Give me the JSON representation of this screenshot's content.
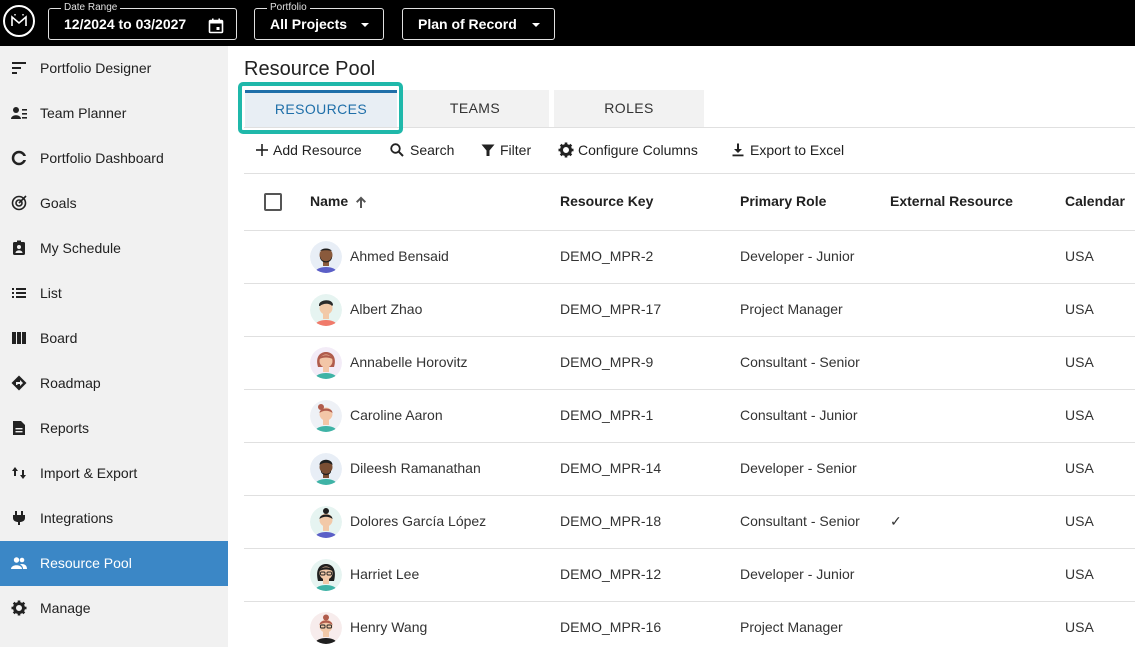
{
  "topbar": {
    "date_range": {
      "legend": "Date Range",
      "value": "12/2024 to 03/2027"
    },
    "portfolio": {
      "legend": "Portfolio",
      "value": "All Projects"
    },
    "plan": {
      "value": "Plan of Record"
    }
  },
  "sidebar": {
    "items": [
      {
        "label": "Portfolio Designer",
        "icon": "portfolio-designer-icon"
      },
      {
        "label": "Team Planner",
        "icon": "team-planner-icon"
      },
      {
        "label": "Portfolio Dashboard",
        "icon": "dashboard-icon"
      },
      {
        "label": "Goals",
        "icon": "goals-icon"
      },
      {
        "label": "My Schedule",
        "icon": "schedule-icon"
      },
      {
        "label": "List",
        "icon": "list-icon"
      },
      {
        "label": "Board",
        "icon": "board-icon"
      },
      {
        "label": "Roadmap",
        "icon": "roadmap-icon"
      },
      {
        "label": "Reports",
        "icon": "reports-icon"
      },
      {
        "label": "Import & Export",
        "icon": "import-export-icon"
      },
      {
        "label": "Integrations",
        "icon": "integrations-icon"
      },
      {
        "label": "Resource Pool",
        "icon": "resource-pool-icon",
        "active": true
      },
      {
        "label": "Manage",
        "icon": "gear-icon"
      }
    ],
    "active_color": "#3b87c6"
  },
  "main": {
    "title": "Resource Pool",
    "tabs": [
      {
        "label": "RESOURCES",
        "active": true
      },
      {
        "label": "TEAMS"
      },
      {
        "label": "ROLES"
      }
    ],
    "highlight_color": "#1fb8aa",
    "toolbar": {
      "add": "Add Resource",
      "search": "Search",
      "filter": "Filter",
      "configure": "Configure Columns",
      "export": "Export to Excel"
    },
    "columns": {
      "name": "Name",
      "key": "Resource Key",
      "role": "Primary Role",
      "external": "External Resource",
      "calendar": "Calendar"
    },
    "rows": [
      {
        "name": "Ahmed Bensaid",
        "key": "DEMO_MPR-2",
        "role": "Developer - Junior",
        "external": "",
        "calendar": "USA"
      },
      {
        "name": "Albert Zhao",
        "key": "DEMO_MPR-17",
        "role": "Project Manager",
        "external": "",
        "calendar": "USA"
      },
      {
        "name": "Annabelle Horovitz",
        "key": "DEMO_MPR-9",
        "role": "Consultant - Senior",
        "external": "",
        "calendar": "USA"
      },
      {
        "name": "Caroline Aaron",
        "key": "DEMO_MPR-1",
        "role": "Consultant - Junior",
        "external": "",
        "calendar": "USA"
      },
      {
        "name": "Dileesh Ramanathan",
        "key": "DEMO_MPR-14",
        "role": "Developer - Senior",
        "external": "",
        "calendar": "USA"
      },
      {
        "name": "Dolores García López",
        "key": "DEMO_MPR-18",
        "role": "Consultant - Senior",
        "external": "✓",
        "calendar": "USA"
      },
      {
        "name": "Harriet Lee",
        "key": "DEMO_MPR-12",
        "role": "Developer - Junior",
        "external": "",
        "calendar": "USA"
      },
      {
        "name": "Henry Wang",
        "key": "DEMO_MPR-16",
        "role": "Project Manager",
        "external": "",
        "calendar": "USA"
      }
    ]
  }
}
